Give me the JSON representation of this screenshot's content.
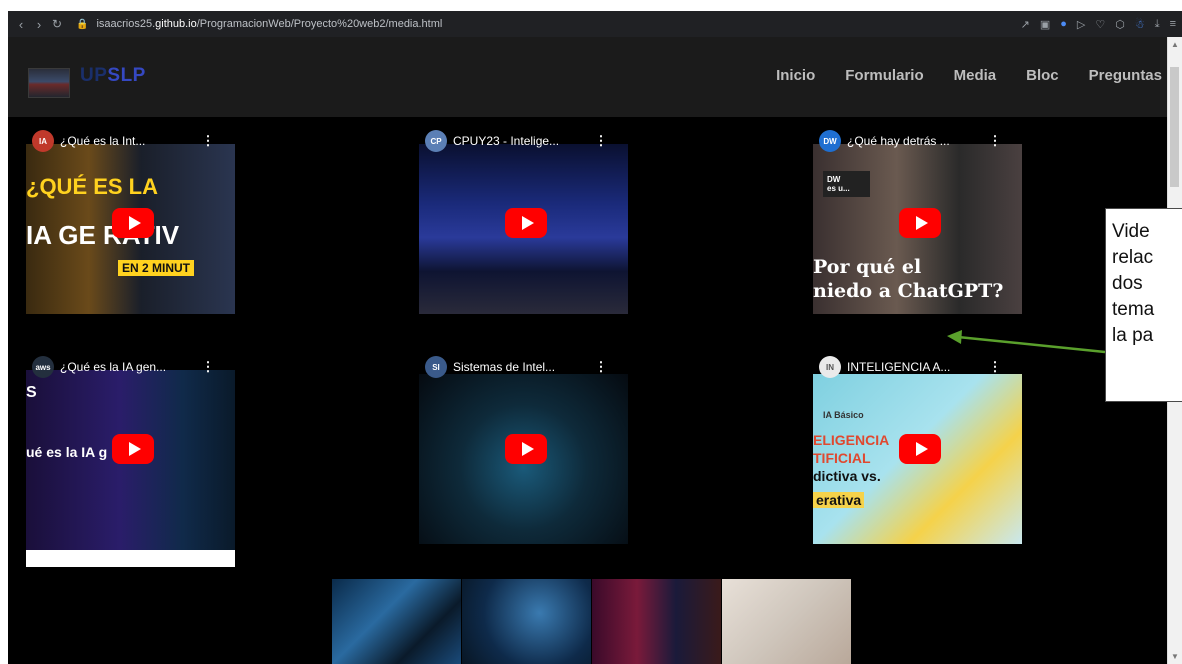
{
  "browser": {
    "url_prefix": "isaacrios25.",
    "url_domain": "github.io",
    "url_path": "/ProgramacionWeb/Proyecto%20web2/media.html"
  },
  "navbar": {
    "brand_up": "UP",
    "brand_slp": "SLP",
    "menu": [
      "Inicio",
      "Formulario",
      "Media",
      "Bloc",
      "Preguntas"
    ]
  },
  "videos": [
    {
      "title": "¿Qué es la Int...",
      "channel_icon": "IA",
      "overlay_lines": [
        "¿QUÉ ES LA",
        "IA GE   RATIV",
        "EN 2 MINUT"
      ]
    },
    {
      "title": "CPUY23 - Intelige...",
      "channel_icon": "CP",
      "overlay_lines": []
    },
    {
      "title": "¿Qué hay detrás ...",
      "channel_icon": "DW",
      "overlay_lines": [
        "Por qué el",
        "niedo a ChatGPT?"
      ],
      "badge": "DW\nes u..."
    },
    {
      "title": "¿Qué es la IA gen...",
      "channel_icon": "aws",
      "overlay_lines": [
        "S",
        "ué es la IA g      va?"
      ]
    },
    {
      "title": "Sistemas de Intel...",
      "channel_icon": "SI",
      "overlay_lines": []
    },
    {
      "title": "INTELIGENCIA A...",
      "channel_icon": "IN",
      "overlay_lines": [
        "IA Básico",
        "ELIGENCIA",
        "TIFICIAL",
        "dictiva vs.",
        "erativa"
      ]
    }
  ],
  "callout": {
    "lines": [
      "Vide",
      "relac",
      "dos",
      "tema",
      "la pa"
    ]
  },
  "colors": {
    "page_bg": "#000000",
    "navbar_bg": "#1b1b1b",
    "play_red": "#ff0000",
    "annotation_arrow": "#5aa02c"
  }
}
